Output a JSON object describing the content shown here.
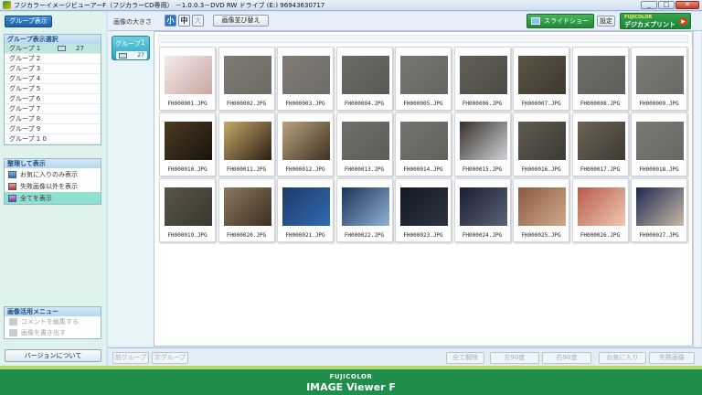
{
  "window": {
    "title": "フジカラーイメージビューアーF（フジカラーCD専用） －1.0.0.3－DVD RW ドライブ (E:) 96943630717",
    "buttons": [
      "_",
      "□",
      "✕"
    ]
  },
  "left": {
    "group_view_button": "グループ表示",
    "group_select": {
      "title": "グループ表示選択",
      "items": [
        {
          "label": "グループ 1",
          "count": "27",
          "selected": true
        },
        {
          "label": "グループ 2"
        },
        {
          "label": "グループ 3"
        },
        {
          "label": "グループ 4"
        },
        {
          "label": "グループ 5"
        },
        {
          "label": "グループ 6"
        },
        {
          "label": "グループ 7"
        },
        {
          "label": "グループ 8"
        },
        {
          "label": "グループ 9"
        },
        {
          "label": "グループ 1 0"
        }
      ]
    },
    "arrange": {
      "title": "整理して表示",
      "items": [
        "お気に入りのみ表示",
        "失敗画像以外を表示",
        "全てを表示"
      ]
    },
    "utility": {
      "title": "画像活用メニュー",
      "items": [
        "コメントを編集する",
        "画像を書き出す"
      ]
    },
    "version_button": "バージョンについて"
  },
  "toolbar": {
    "size_label": "画像の大きさ",
    "size_small": "小",
    "size_mid": "中",
    "size_large": "大",
    "sort_button": "画像並び替え",
    "slideshow_button": "スライドショー",
    "settings_button": "設定",
    "fuji_brand": "FUJICOLOR",
    "fuji_label": "デジカメプリント"
  },
  "group_tab": {
    "name": "グループ",
    "number": "1",
    "count": "27"
  },
  "thumbnails": [
    {
      "file": "FH000001.JPG",
      "tone": [
        "#f3ecea",
        "#c9a6a0"
      ]
    },
    {
      "file": "FH000002.JPG",
      "tone": [
        "#7c7a72",
        "#6d6b64"
      ]
    },
    {
      "file": "FH000003.JPG",
      "tone": [
        "#7e7c74",
        "#6e6c66"
      ]
    },
    {
      "file": "FH000004.JPG",
      "tone": [
        "#6c6b64",
        "#5a5954"
      ]
    },
    {
      "file": "FH000005.JPG",
      "tone": [
        "#787670",
        "#66655f"
      ]
    },
    {
      "file": "FH000006.JPG",
      "tone": [
        "#646058",
        "#4c4a44"
      ]
    },
    {
      "file": "FH000007.JPG",
      "tone": [
        "#5d5546",
        "#3c3830"
      ]
    },
    {
      "file": "FH000008.JPG",
      "tone": [
        "#6e6d67",
        "#5f5e58"
      ]
    },
    {
      "file": "FH000009.JPG",
      "tone": [
        "#7b7a74",
        "#6a6963"
      ]
    },
    {
      "file": "FH000010.JPG",
      "tone": [
        "#4c3a24",
        "#1b140c"
      ]
    },
    {
      "file": "FH000011.JPG",
      "tone": [
        "#c7a86a",
        "#2b1f12"
      ]
    },
    {
      "file": "FH000012.JPG",
      "tone": [
        "#b9a37c",
        "#3e3222"
      ]
    },
    {
      "file": "FH000013.JPG",
      "tone": [
        "#706e68",
        "#5e5c57"
      ]
    },
    {
      "file": "FH000014.JPG",
      "tone": [
        "#75736d",
        "#63615c"
      ]
    },
    {
      "file": "FH000015.JPG",
      "tone": [
        "#38302a",
        "#cfd2d8"
      ]
    },
    {
      "file": "FH000016.JPG",
      "tone": [
        "#5f5b50",
        "#3d3a33"
      ]
    },
    {
      "file": "FH000017.JPG",
      "tone": [
        "#6b6456",
        "#3e3a32"
      ]
    },
    {
      "file": "FH000018.JPG",
      "tone": [
        "#7a7872",
        "#6a6863"
      ]
    },
    {
      "file": "FH000019.JPG",
      "tone": [
        "#5a5547",
        "#3a372e"
      ]
    },
    {
      "file": "FH000020.JPG",
      "tone": [
        "#8c7a62",
        "#3a2e20"
      ]
    },
    {
      "file": "FH000021.JPG",
      "tone": [
        "#1f3a6a",
        "#2f6ab0"
      ]
    },
    {
      "file": "FH000022.JPG",
      "tone": [
        "#1a3558",
        "#8fb0d6"
      ]
    },
    {
      "file": "FH000023.JPG",
      "tone": [
        "#141a24",
        "#2c3340"
      ]
    },
    {
      "file": "FH000024.JPG",
      "tone": [
        "#1a2030",
        "#5a6276"
      ]
    },
    {
      "file": "FH000025.JPG",
      "tone": [
        "#8a5a3e",
        "#cfa88a"
      ]
    },
    {
      "file": "FH000026.JPG",
      "tone": [
        "#b85a4a",
        "#efc9b4"
      ]
    },
    {
      "file": "FH000027.JPG",
      "tone": [
        "#1b2a52",
        "#c9b8a6"
      ]
    }
  ],
  "bottom": {
    "prev_group": "前グループ",
    "next_group": "次グループ",
    "clear_all": "全て解除",
    "rotate_left": "左90度",
    "rotate_right": "右90度",
    "favorite": "お気に入り",
    "failed": "失敗画像"
  },
  "footer": {
    "brand": "FUJICOLOR",
    "product": "IMAGE Viewer F"
  }
}
